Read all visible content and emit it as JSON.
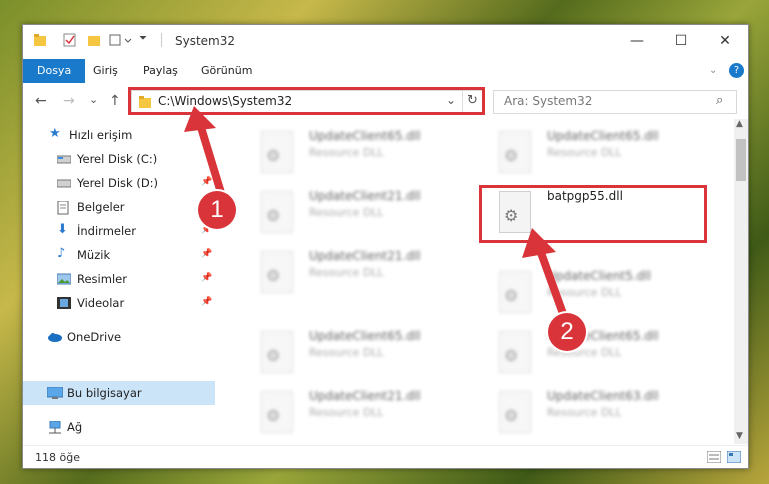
{
  "window": {
    "title": "System32",
    "minimize": "—",
    "maximize": "☐",
    "close": "✕"
  },
  "ribbon": {
    "tabs": [
      "Dosya",
      "Giriş",
      "Paylaş",
      "Görünüm"
    ]
  },
  "nav": {
    "back": "←",
    "forward": "→",
    "recent": "⌄",
    "up": "↑",
    "refresh": "↻",
    "dropdown": "⌄"
  },
  "address": {
    "path": "C:\\Windows\\System32"
  },
  "search": {
    "placeholder": "Ara: System32",
    "icon": "⌕"
  },
  "sidebar": {
    "items": [
      {
        "label": "Hızlı erişim",
        "icon": "star-icon"
      },
      {
        "label": "Yerel Disk (C:)",
        "icon": "drive-icon",
        "pinned": true
      },
      {
        "label": "Yerel Disk (D:)",
        "icon": "drive-icon",
        "pinned": true
      },
      {
        "label": "Belgeler",
        "icon": "documents-icon",
        "pinned": true
      },
      {
        "label": "İndirmeler",
        "icon": "download-icon",
        "pinned": true
      },
      {
        "label": "Müzik",
        "icon": "music-icon",
        "pinned": true
      },
      {
        "label": "Resimler",
        "icon": "pictures-icon",
        "pinned": true
      },
      {
        "label": "Videolar",
        "icon": "video-icon",
        "pinned": true
      },
      {
        "label": "OneDrive",
        "icon": "cloud-icon"
      },
      {
        "label": "Bu bilgisayar",
        "icon": "computer-icon",
        "selected": true
      },
      {
        "label": "Ağ",
        "icon": "network-icon"
      }
    ]
  },
  "files": [
    {
      "name": "UpdateClient65.dll",
      "type": "Resource DLL"
    },
    {
      "name": "UpdateClient65.dll",
      "type": "Resource DLL"
    },
    {
      "name": "UpdateClient21.dll",
      "type": "Resource DLL"
    },
    {
      "name": "batpgp55.dll",
      "type": ""
    },
    {
      "name": "UpdateClient21.dll",
      "type": "Resource DLL"
    },
    {
      "name": "UpdateClient5.dll",
      "type": "Resource DLL"
    },
    {
      "name": "UpdateClient65.dll",
      "type": "Resource DLL"
    },
    {
      "name": "UpdateClient65.dll",
      "type": "Resource DLL"
    },
    {
      "name": "UpdateClient21.dll",
      "type": "Resource DLL"
    },
    {
      "name": "UpdateClient63.dll",
      "type": "Resource DLL"
    }
  ],
  "status": {
    "count": "118 öğe"
  },
  "callouts": [
    "1",
    "2"
  ],
  "colors": {
    "accent": "#1979ca",
    "highlight": "#d9343a",
    "selected": "#cce4f7"
  }
}
